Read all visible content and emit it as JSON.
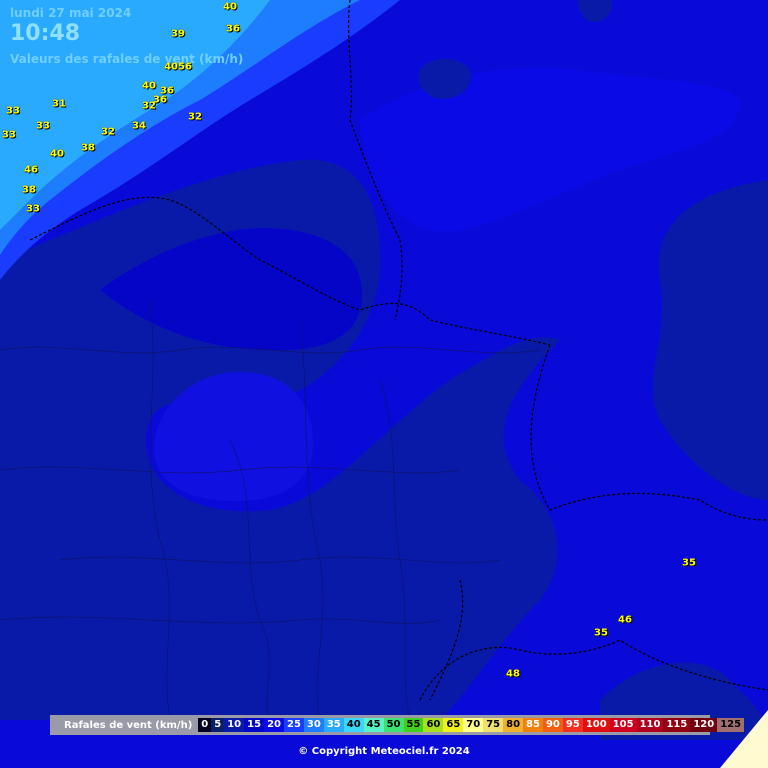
{
  "header": {
    "date": "lundi 27 mai 2024",
    "time": "10:48",
    "subtitle": "Valeurs des rafales de vent (km/h)"
  },
  "gust_labels": [
    "40",
    "36",
    "39",
    "4056",
    "40",
    "36",
    "36",
    "32",
    "32",
    "31",
    "33",
    "33",
    "33",
    "34",
    "32",
    "40",
    "38",
    "46",
    "38",
    "33",
    "35",
    "46",
    "35",
    "48"
  ],
  "legend": {
    "title": "Rafales de vent (km/h)",
    "bins": [
      {
        "v": "0",
        "bg": "#000020",
        "fg": "#ffffff"
      },
      {
        "v": "5",
        "bg": "#0a1f6a",
        "fg": "#ffffff"
      },
      {
        "v": "10",
        "bg": "#0a1aa8",
        "fg": "#ffffff"
      },
      {
        "v": "15",
        "bg": "#0505c8",
        "fg": "#ffffff"
      },
      {
        "v": "20",
        "bg": "#0a0ae6",
        "fg": "#ffffff"
      },
      {
        "v": "25",
        "bg": "#1a3cff",
        "fg": "#ffffff"
      },
      {
        "v": "30",
        "bg": "#1e7cff",
        "fg": "#ffffff"
      },
      {
        "v": "35",
        "bg": "#2aaaff",
        "fg": "#ffffff"
      },
      {
        "v": "40",
        "bg": "#3ad6ff",
        "fg": "#000000"
      },
      {
        "v": "45",
        "bg": "#5af0c8",
        "fg": "#000000"
      },
      {
        "v": "50",
        "bg": "#40e070",
        "fg": "#000000"
      },
      {
        "v": "55",
        "bg": "#40d020",
        "fg": "#000000"
      },
      {
        "v": "60",
        "bg": "#a8e020",
        "fg": "#000000"
      },
      {
        "v": "65",
        "bg": "#f0f020",
        "fg": "#000000"
      },
      {
        "v": "70",
        "bg": "#ffff90",
        "fg": "#000000"
      },
      {
        "v": "75",
        "bg": "#f0e070",
        "fg": "#000000"
      },
      {
        "v": "80",
        "bg": "#f0b030",
        "fg": "#000000"
      },
      {
        "v": "85",
        "bg": "#f08010",
        "fg": "#ffffff"
      },
      {
        "v": "90",
        "bg": "#f06010",
        "fg": "#ffffff"
      },
      {
        "v": "95",
        "bg": "#f03020",
        "fg": "#ffffff"
      },
      {
        "v": "100",
        "bg": "#e01010",
        "fg": "#ffffff"
      },
      {
        "v": "105",
        "bg": "#d00020",
        "fg": "#ffffff"
      },
      {
        "v": "110",
        "bg": "#b00020",
        "fg": "#ffffff"
      },
      {
        "v": "115",
        "bg": "#900010",
        "fg": "#ffffff"
      },
      {
        "v": "120",
        "bg": "#700010",
        "fg": "#ffffff"
      },
      {
        "v": "125",
        "bg": "#a07070",
        "fg": "#000000"
      }
    ]
  },
  "copyright": "© Copyright Meteociel.fr 2024"
}
